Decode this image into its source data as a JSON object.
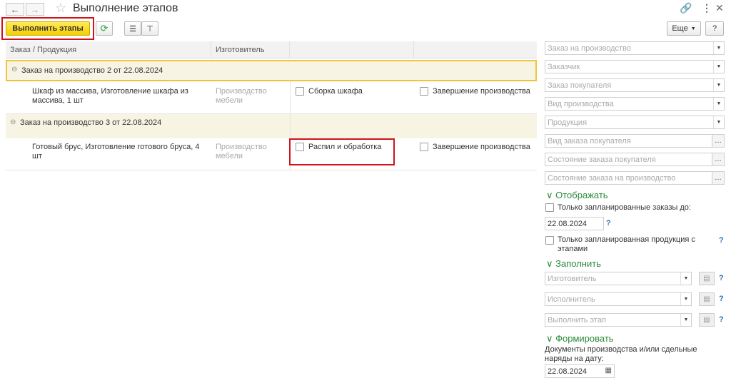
{
  "window": {
    "title": "Выполнение этапов"
  },
  "toolbar": {
    "execute_label": "Выполнить этапы",
    "more_label": "Еще",
    "help_label": "?"
  },
  "table": {
    "columns": [
      "Заказ / Продукция",
      "Изготовитель"
    ],
    "groups": [
      {
        "title": "Заказ на производство 2 от 22.08.2024",
        "rows": [
          {
            "product": "Шкаф из массива, Изготовление шкафа из массива, 1 шт",
            "maker": "Производство мебели",
            "stage1": "Сборка шкафа",
            "stage2": "Завершение производства"
          }
        ]
      },
      {
        "title": "Заказ на производство 3 от 22.08.2024",
        "rows": [
          {
            "product": "Готовый брус, Изготовление готового бруса, 4 шт",
            "maker": "Производство мебели",
            "stage1": "Распил и обработка",
            "stage2": "Завершение производства"
          }
        ]
      }
    ]
  },
  "filters": {
    "production_order": "Заказ на производство",
    "customer": "Заказчик",
    "customer_order": "Заказ покупателя",
    "production_type": "Вид производства",
    "product": "Продукция",
    "customer_order_type": "Вид заказа покупателя",
    "customer_order_state": "Состояние заказа покупателя",
    "production_order_state": "Состояние заказа на производство"
  },
  "display": {
    "header": "Отображать",
    "only_planned_orders": "Только запланированные заказы до:",
    "date": "22.08.2024",
    "only_planned_products": "Только запланированная продукция с этапами"
  },
  "fill": {
    "header": "Заполнить",
    "maker": "Изготовитель",
    "executor": "Исполнитель",
    "execute_stage": "Выполнить этап"
  },
  "form": {
    "header": "Формировать",
    "description": "Документы производства и/или сдельные наряды на дату:",
    "date": "22.08.2024"
  },
  "help_mark": "?"
}
